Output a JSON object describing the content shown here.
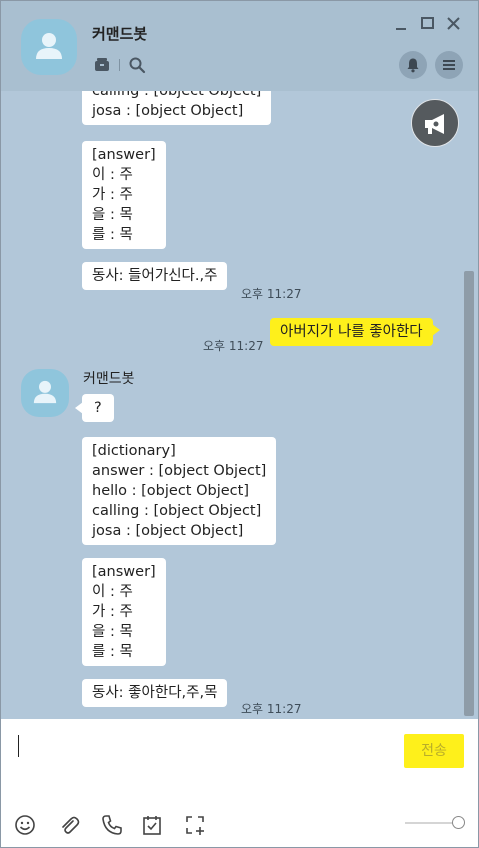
{
  "header": {
    "title": "커맨드봇"
  },
  "messages": {
    "m1": "calling : [object Object]\njosa : [object Object]",
    "m2": "[answer]\n이 : 주\n가 : 주\n을 : 목\n를 : 목",
    "m3": "동사: 들어가신다.,주",
    "m3_time": "오후 11:27",
    "m4": "아버지가 나를 좋아한다",
    "m4_time": "오후 11:27",
    "sender": "커맨드봇",
    "m5": "?",
    "m6": "[dictionary]\nanswer : [object Object]\nhello : [object Object]\ncalling : [object Object]\njosa : [object Object]",
    "m7": "[answer]\n이 : 주\n가 : 주\n을 : 목\n를 : 목",
    "m8": "동사: 좋아한다,주,목",
    "m8_time": "오후 11:27"
  },
  "input": {
    "send_label": "전송"
  },
  "colors": {
    "chat_bg": "#b2c7d9",
    "my_bubble": "#fef01b",
    "other_bubble": "#ffffff"
  },
  "icons": [
    "minimize-icon",
    "maximize-icon",
    "close-icon",
    "archive-icon",
    "search-icon",
    "bell-icon",
    "menu-icon",
    "megaphone-icon",
    "emoji-icon",
    "attach-icon",
    "phone-icon",
    "calendar-icon",
    "capture-icon"
  ]
}
